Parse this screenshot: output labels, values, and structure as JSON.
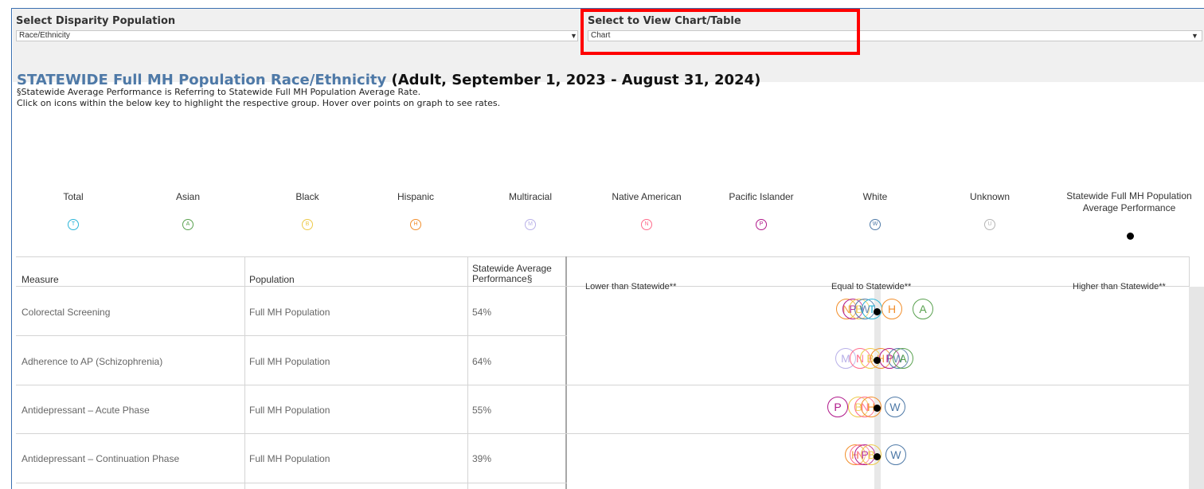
{
  "filters": {
    "disparity": {
      "label": "Select Disparity Population",
      "value": "Race/Ethnicity"
    },
    "view": {
      "label": "Select to View Chart/Table",
      "value": "Chart"
    }
  },
  "title": {
    "main": "STATEWIDE Full MH Population Race/Ethnicity",
    "period": "(Adult, September 1, 2023 - August 31, 2024)",
    "note1": "§Statewide Average Performance is Referring to Statewide Full MH Population Average Rate.",
    "note2": "Click on icons within the below key to highlight the respective group. Hover over points on graph to see rates."
  },
  "legend": [
    {
      "name": "Total",
      "letter": "T",
      "color": "#2bb5d8"
    },
    {
      "name": "Asian",
      "letter": "A",
      "color": "#59a14f"
    },
    {
      "name": "Black",
      "letter": "B",
      "color": "#edc948"
    },
    {
      "name": "Hispanic",
      "letter": "H",
      "color": "#f28e2b"
    },
    {
      "name": "Multiracial",
      "letter": "M",
      "color": "#b8b0e8"
    },
    {
      "name": "Native American",
      "letter": "N",
      "color": "#ff6b8b"
    },
    {
      "name": "Pacific Islander",
      "letter": "P",
      "color": "#b0188a"
    },
    {
      "name": "White",
      "letter": "W",
      "color": "#4e79a7"
    },
    {
      "name": "Unknown",
      "letter": "U",
      "color": "#b4b4b4"
    }
  ],
  "legend_avg": {
    "name": "Statewide Full MH Population Average Performance"
  },
  "table": {
    "headers": {
      "measure": "Measure",
      "population": "Population",
      "statewide": "Statewide Average Performance§"
    },
    "zones": {
      "lower": "Lower than Statewide**",
      "equal": "Equal to Statewide**",
      "higher": "Higher than Statewide**"
    },
    "rows": [
      {
        "measure": "Colorectal Screening",
        "population": "Full MH Population",
        "statewide": "54%"
      },
      {
        "measure": "Adherence to AP (Schizophrenia)",
        "population": "Full MH Population",
        "statewide": "64%"
      },
      {
        "measure": "Antidepressant – Acute Phase",
        "population": "Full MH Population",
        "statewide": "55%"
      },
      {
        "measure": "Antidepressant – Continuation Phase",
        "population": "Full MH Population",
        "statewide": "39%"
      }
    ]
  }
}
